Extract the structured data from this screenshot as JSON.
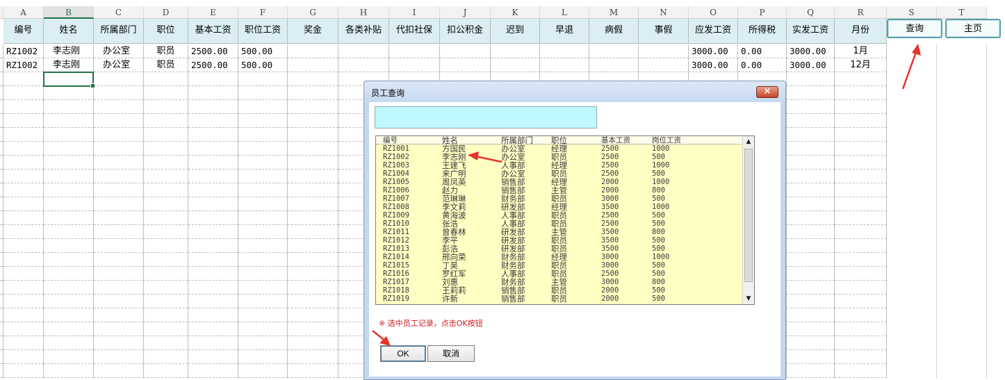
{
  "columns": [
    "A",
    "B",
    "C",
    "D",
    "E",
    "F",
    "G",
    "H",
    "I",
    "J",
    "K",
    "L",
    "M",
    "N",
    "O",
    "P",
    "Q",
    "R",
    "S",
    "T"
  ],
  "selected_column": "B",
  "headers": [
    "编号",
    "姓名",
    "所属部门",
    "职位",
    "基本工资",
    "职位工资",
    "奖金",
    "各类补贴",
    "代扣社保",
    "扣公积金",
    "迟到",
    "早退",
    "病假",
    "事假",
    "应发工资",
    "所得税",
    "实发工资",
    "月份"
  ],
  "rows": [
    {
      "id": "RZ1002",
      "name": "李志刚",
      "dept": "办公室",
      "position": "职员",
      "base": "2500.00",
      "pos_pay": "500.00",
      "gross": "3000.00",
      "tax": "0.00",
      "net": "3000.00",
      "month": "1月"
    },
    {
      "id": "RZ1002",
      "name": "李志刚",
      "dept": "办公室",
      "position": "职员",
      "base": "2500.00",
      "pos_pay": "500.00",
      "gross": "3000.00",
      "tax": "0.00",
      "net": "3000.00",
      "month": "12月"
    }
  ],
  "sheet_buttons": {
    "query": "查询",
    "home": "主页"
  },
  "dialog": {
    "title": "员工查询",
    "close_glyph": "×",
    "search_value": "",
    "list_headers": [
      "编号",
      "姓名",
      "所属部门",
      "职位",
      "基本工资",
      "岗位工资"
    ],
    "list": [
      [
        "RZ1001",
        "方国民",
        "办公室",
        "经理",
        "2500",
        "1000"
      ],
      [
        "RZ1002",
        "李志刚",
        "办公室",
        "职员",
        "2500",
        "500"
      ],
      [
        "RZ1003",
        "王建飞",
        "人事部",
        "经理",
        "2500",
        "1000"
      ],
      [
        "RZ1004",
        "来广明",
        "办公室",
        "职员",
        "2500",
        "500"
      ],
      [
        "RZ1005",
        "周凤英",
        "销售部",
        "经理",
        "2000",
        "1000"
      ],
      [
        "RZ1006",
        "赵力",
        "销售部",
        "主管",
        "2000",
        "800"
      ],
      [
        "RZ1007",
        "范琳琳",
        "财务部",
        "职员",
        "3000",
        "500"
      ],
      [
        "RZ1008",
        "李文莉",
        "研发部",
        "经理",
        "3500",
        "1000"
      ],
      [
        "RZ1009",
        "黄海波",
        "人事部",
        "职员",
        "2500",
        "500"
      ],
      [
        "RZ1010",
        "张浩",
        "人事部",
        "职员",
        "2500",
        "500"
      ],
      [
        "RZ1011",
        "曾春林",
        "研发部",
        "主管",
        "3500",
        "800"
      ],
      [
        "RZ1012",
        "李平",
        "研发部",
        "职员",
        "3500",
        "500"
      ],
      [
        "RZ1013",
        "彭浩",
        "研发部",
        "职员",
        "3500",
        "500"
      ],
      [
        "RZ1014",
        "邢向荣",
        "财务部",
        "经理",
        "3000",
        "1000"
      ],
      [
        "RZ1015",
        "丁昊",
        "财务部",
        "职员",
        "3000",
        "500"
      ],
      [
        "RZ1016",
        "罗红军",
        "人事部",
        "职员",
        "2500",
        "500"
      ],
      [
        "RZ1017",
        "刘惠",
        "财务部",
        "主管",
        "3000",
        "800"
      ],
      [
        "RZ1018",
        "王莉莉",
        "销售部",
        "职员",
        "2000",
        "500"
      ],
      [
        "RZ1019",
        "许新",
        "销售部",
        "职员",
        "2000",
        "500"
      ]
    ],
    "hint": "※  选中员工记录，点击OK按钮",
    "ok": "OK",
    "cancel": "取消"
  },
  "colors": {
    "header_fill": "#dbeef4",
    "accent": "#217346",
    "search_fill": "#bff8ff",
    "list_fill": "#ffffc4",
    "arrow": "#e8322a"
  },
  "icons": [
    "close-icon",
    "scroll-up-icon",
    "scroll-down-icon",
    "arrow-pointer-icon"
  ]
}
